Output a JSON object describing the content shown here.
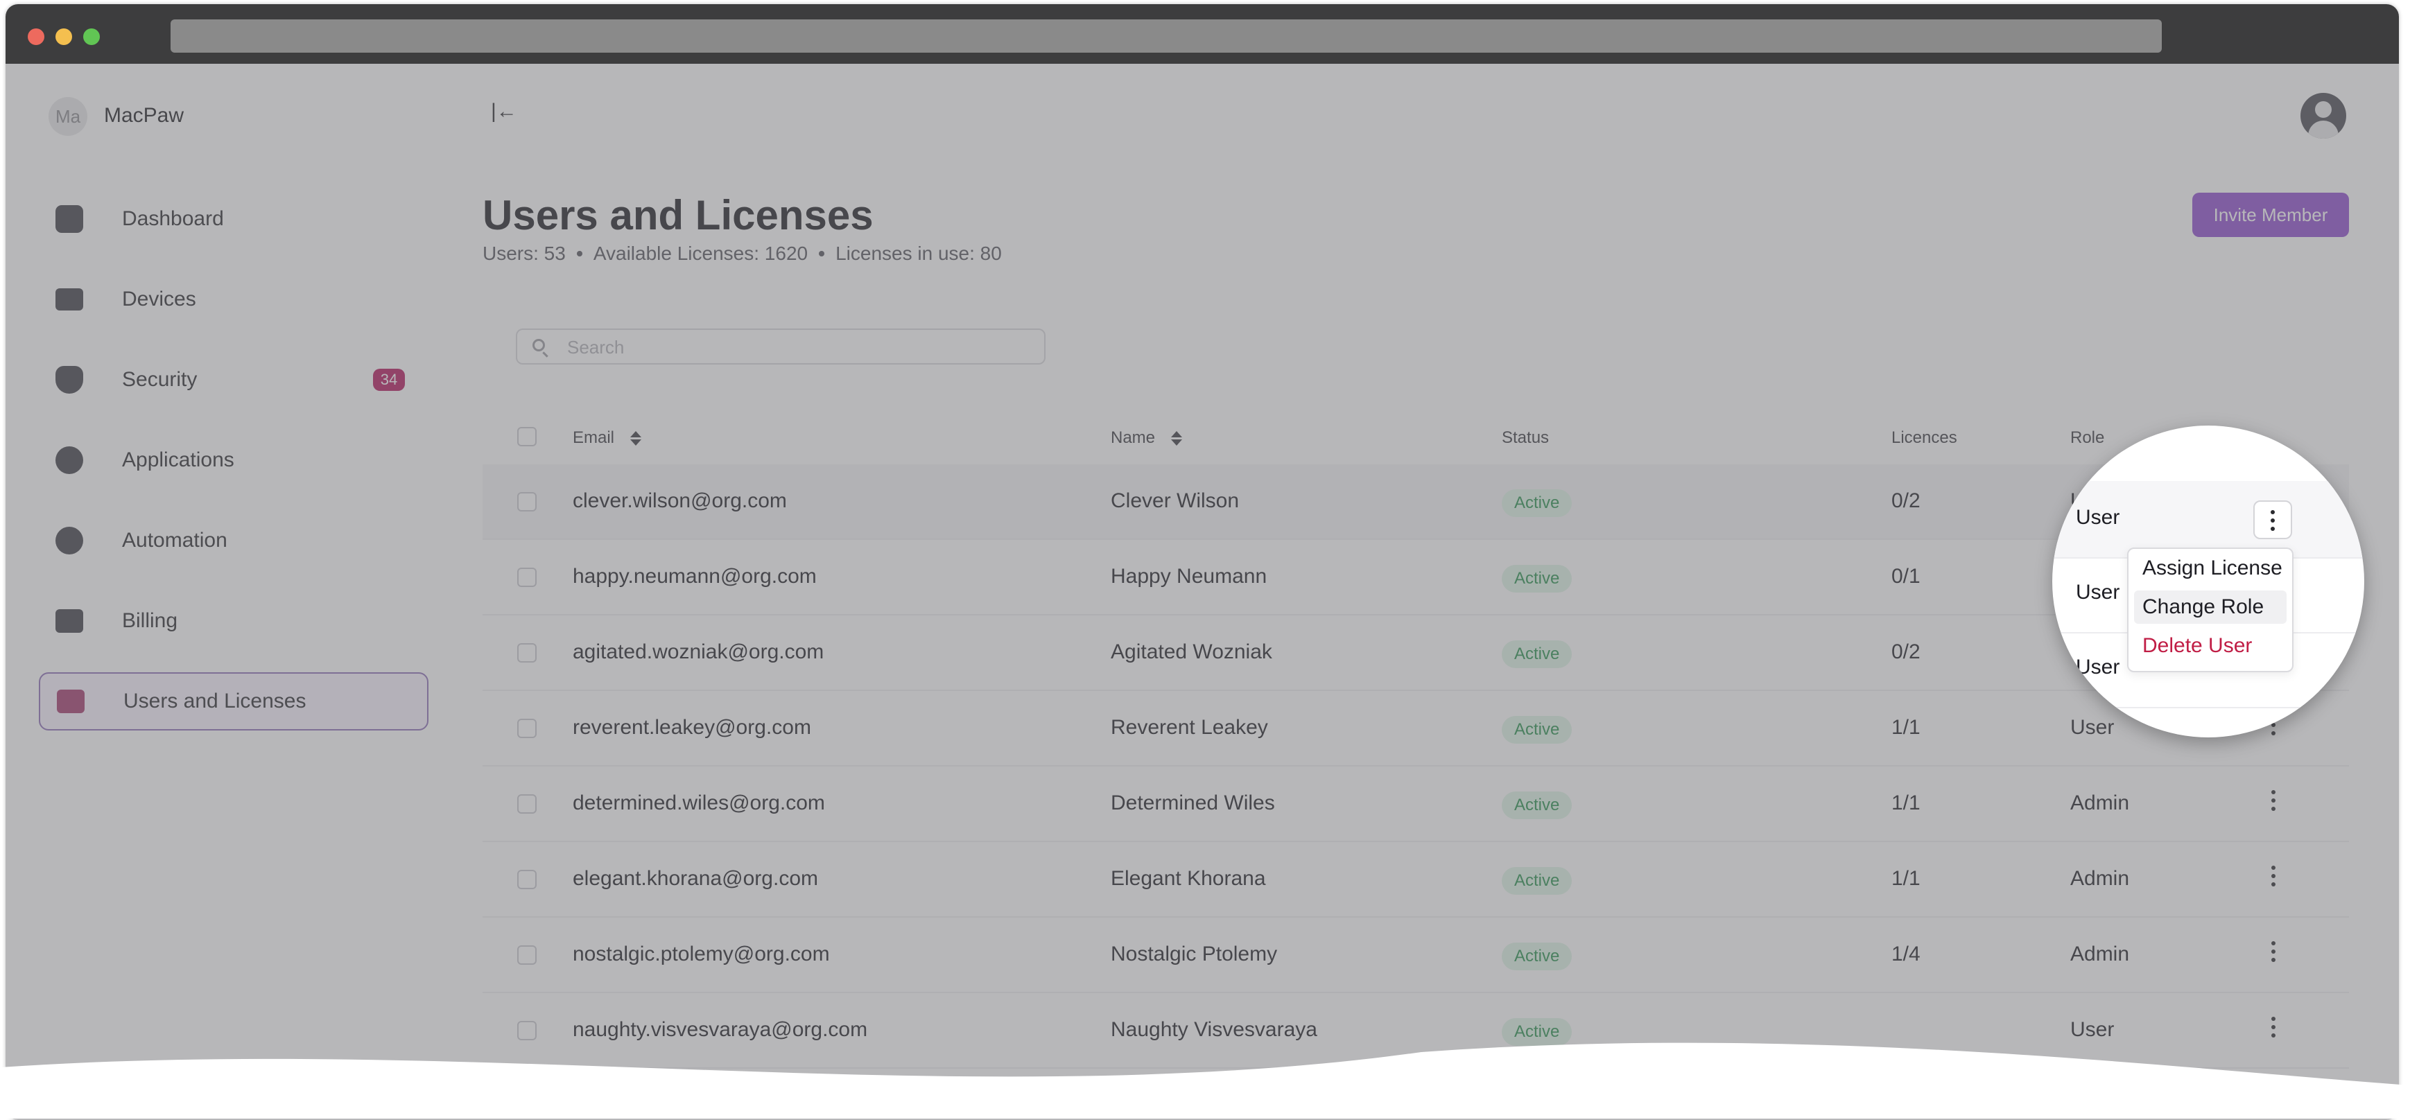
{
  "org": {
    "avatar_initials": "Ma",
    "name": "MacPaw"
  },
  "sidebar": {
    "items": [
      {
        "label": "Dashboard",
        "icon": "dashboard-icon",
        "badge": ""
      },
      {
        "label": "Devices",
        "icon": "devices-icon",
        "badge": ""
      },
      {
        "label": "Security",
        "icon": "shield-icon",
        "badge": "34"
      },
      {
        "label": "Applications",
        "icon": "applications-icon",
        "badge": ""
      },
      {
        "label": "Automation",
        "icon": "automation-icon",
        "badge": ""
      },
      {
        "label": "Billing",
        "icon": "billing-icon",
        "badge": ""
      },
      {
        "label": "Users and Licenses",
        "icon": "users-licenses-icon",
        "badge": "",
        "active": true
      }
    ]
  },
  "header": {
    "collapse_glyph": "|←",
    "title": "Users and Licenses",
    "stats": {
      "users": "Users: 53",
      "available": "Available Licenses: 1620",
      "in_use": "Licenses in use: 80"
    },
    "invite_label": "Invite Member"
  },
  "search": {
    "placeholder": "Search",
    "value": ""
  },
  "table": {
    "columns": {
      "email": "Email",
      "name": "Name",
      "status": "Status",
      "licences": "Licences",
      "role": "Role"
    },
    "rows": [
      {
        "email": "clever.wilson@org.com",
        "name": "Clever Wilson",
        "status": "Active",
        "licences": "0/2",
        "role": "User"
      },
      {
        "email": "happy.neumann@org.com",
        "name": "Happy Neumann",
        "status": "Active",
        "licences": "0/1",
        "role": "User"
      },
      {
        "email": "agitated.wozniak@org.com",
        "name": "Agitated Wozniak",
        "status": "Active",
        "licences": "0/2",
        "role": "User"
      },
      {
        "email": "reverent.leakey@org.com",
        "name": "Reverent Leakey",
        "status": "Active",
        "licences": "1/1",
        "role": "User"
      },
      {
        "email": "determined.wiles@org.com",
        "name": "Determined Wiles",
        "status": "Active",
        "licences": "1/1",
        "role": "Admin"
      },
      {
        "email": "elegant.khorana@org.com",
        "name": "Elegant Khorana",
        "status": "Active",
        "licences": "1/1",
        "role": "Admin"
      },
      {
        "email": "nostalgic.ptolemy@org.com",
        "name": "Nostalgic Ptolemy",
        "status": "Active",
        "licences": "1/4",
        "role": "Admin"
      },
      {
        "email": "naughty.visvesvaraya@org.com",
        "name": "Naughty Visvesvaraya",
        "status": "Active",
        "licences": "",
        "role": "User"
      }
    ]
  },
  "context_menu": {
    "items": [
      {
        "label": "Assign License"
      },
      {
        "label": "Change Role"
      },
      {
        "label": "Delete User"
      }
    ]
  },
  "colors": {
    "accent": "#8e4dcf",
    "badge": "#b5175c",
    "status_bg": "#dff5e6",
    "status_text": "#27904d",
    "danger": "#c01d45"
  }
}
